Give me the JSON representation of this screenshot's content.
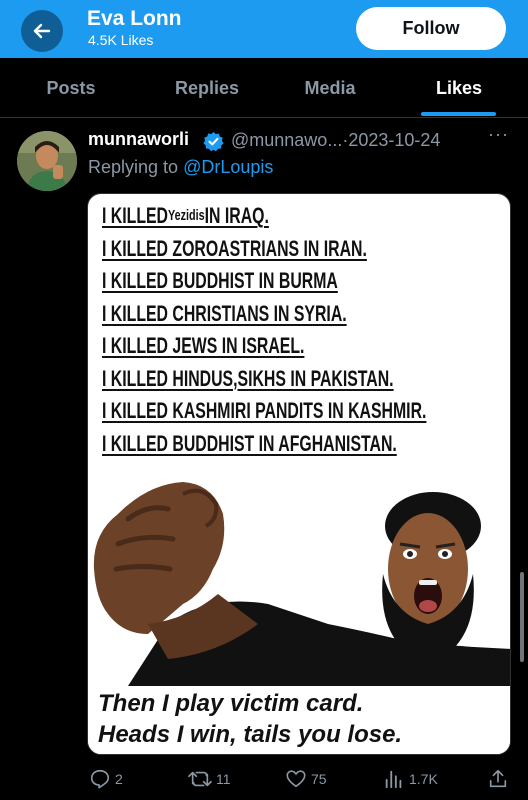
{
  "header": {
    "title": "Eva Lonn",
    "subtitle": "4.5K Likes",
    "follow_label": "Follow"
  },
  "tabs": [
    {
      "label": "Posts",
      "active": false
    },
    {
      "label": "Replies",
      "active": false
    },
    {
      "label": "Media",
      "active": false
    },
    {
      "label": "Likes",
      "active": true
    }
  ],
  "tweet": {
    "author_name": "munnaworli",
    "verified": true,
    "handle": "@munnawo...",
    "separator": "·",
    "date": "2023-10-24",
    "more": "···",
    "reply_prefix": "Replying to",
    "reply_to": "@DrLoupis",
    "media": {
      "lines": [
        {
          "pre": "I KILLED",
          "small": "Yezidis",
          "post": "IN IRAQ."
        },
        {
          "pre": "I KILLED ZOROASTRIANS IN IRAN."
        },
        {
          "pre": "I KILLED BUDDHIST IN BURMA"
        },
        {
          "pre": "I KILLED CHRISTIANS IN SYRIA."
        },
        {
          "pre": "I KILLED JEWS IN ISRAEL."
        },
        {
          "pre": "I KILLED HINDUS,SIKHS IN PAKISTAN."
        },
        {
          "pre": "I KILLED KASHMIRI PANDITS IN KASHMIR."
        },
        {
          "pre": "I KILLED BUDDHIST IN AFGHANISTAN."
        }
      ],
      "caption_line1": "Then I play victim card.",
      "caption_line2": "Heads I win, tails you lose."
    },
    "actions": {
      "replies": "2",
      "reposts": "11",
      "likes": "75",
      "views": "1.7K"
    }
  },
  "colors": {
    "accent": "#1d9bf0",
    "background": "#000000",
    "secondary_text": "#8b98a5"
  },
  "icons": [
    "back-arrow-icon",
    "verified-badge-icon",
    "more-icon",
    "reply-icon",
    "repost-icon",
    "like-icon",
    "views-icon",
    "share-icon"
  ]
}
